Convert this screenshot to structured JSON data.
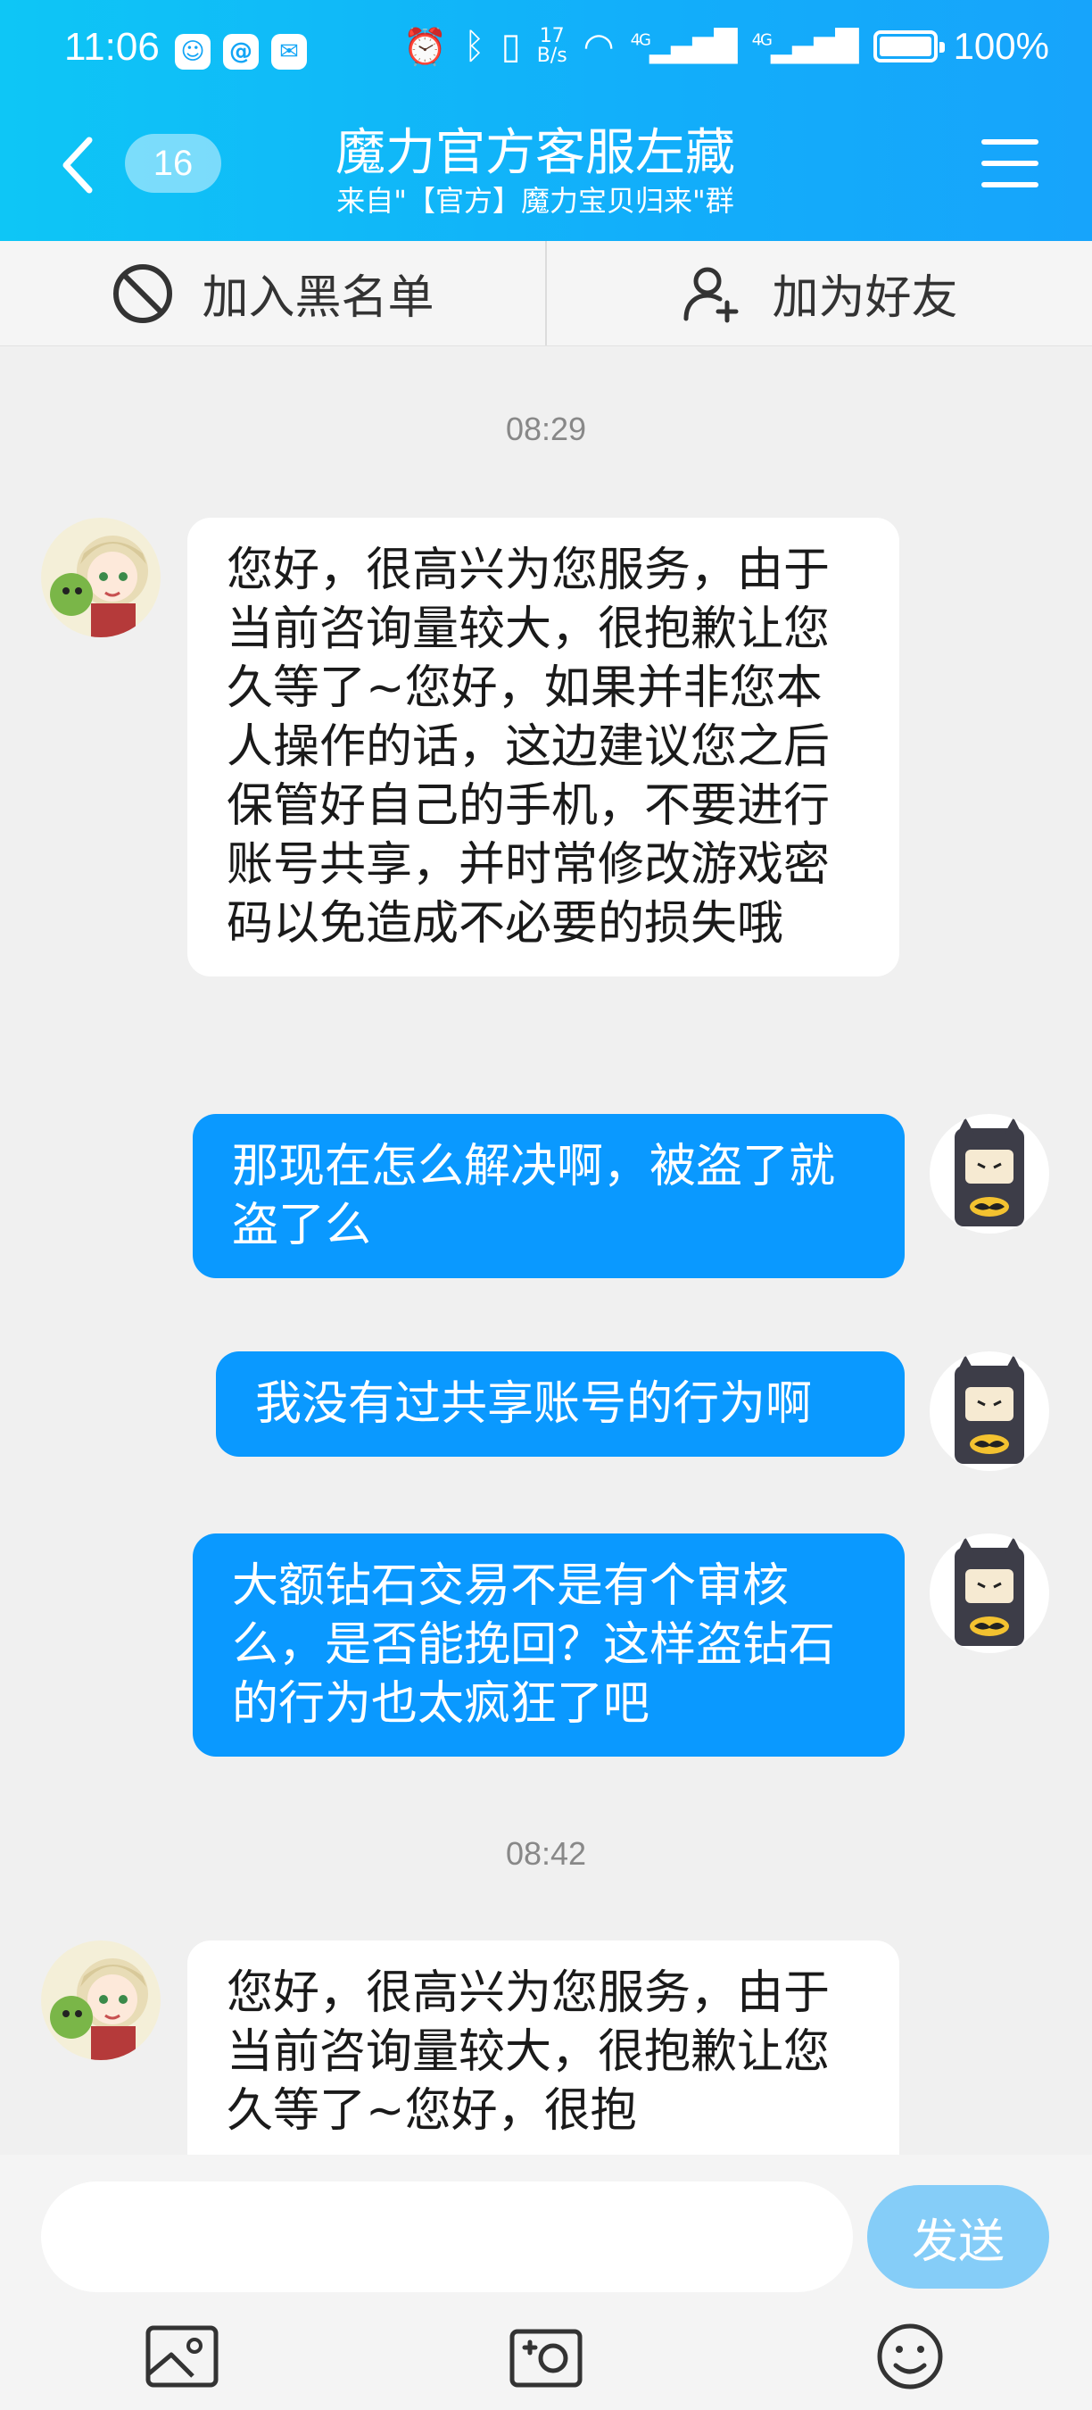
{
  "status_bar": {
    "time": "11:06",
    "net_speed_value": "17",
    "net_speed_unit": "B/s",
    "signal_1": "4G",
    "signal_2": "4G",
    "battery": "100%",
    "app_icons": [
      "robot-app-icon",
      "browser-app-icon",
      "chat-app-icon"
    ]
  },
  "header": {
    "unread_count": "16",
    "title": "魔力官方客服左藏",
    "subtitle": "来自\"【官方】魔力宝贝归来\"群"
  },
  "action_bar": {
    "blacklist_label": "加入黑名单",
    "add_friend_label": "加为好友"
  },
  "messages": {
    "time_1": "08:29",
    "m1": "您好，很高兴为您服务，由于当前咨询量较大，很抱歉让您久等了~您好，如果并非您本人操作的话，这边建议您之后保管好自己的手机，不要进行账号共享，并时常修改游戏密码以免造成不必要的损失哦",
    "m2": "那现在怎么解决啊，被盗了就盗了么",
    "m3": "我没有过共享账号的行为啊",
    "m4": "大额钻石交易不是有个审核么，是否能挽回？这样盗钻石的行为也太疯狂了吧",
    "time_2": "08:42",
    "m5": "您好，很高兴为您服务，由于当前咨询量较大，很抱歉让您久等了~您好，很抱"
  },
  "input": {
    "placeholder": "",
    "send_label": "发送"
  },
  "colors": {
    "header": "#12aefa",
    "outgoing_bubble": "#0a99ff",
    "incoming_bubble": "#ffffff",
    "send_button": "#85cdf8"
  }
}
